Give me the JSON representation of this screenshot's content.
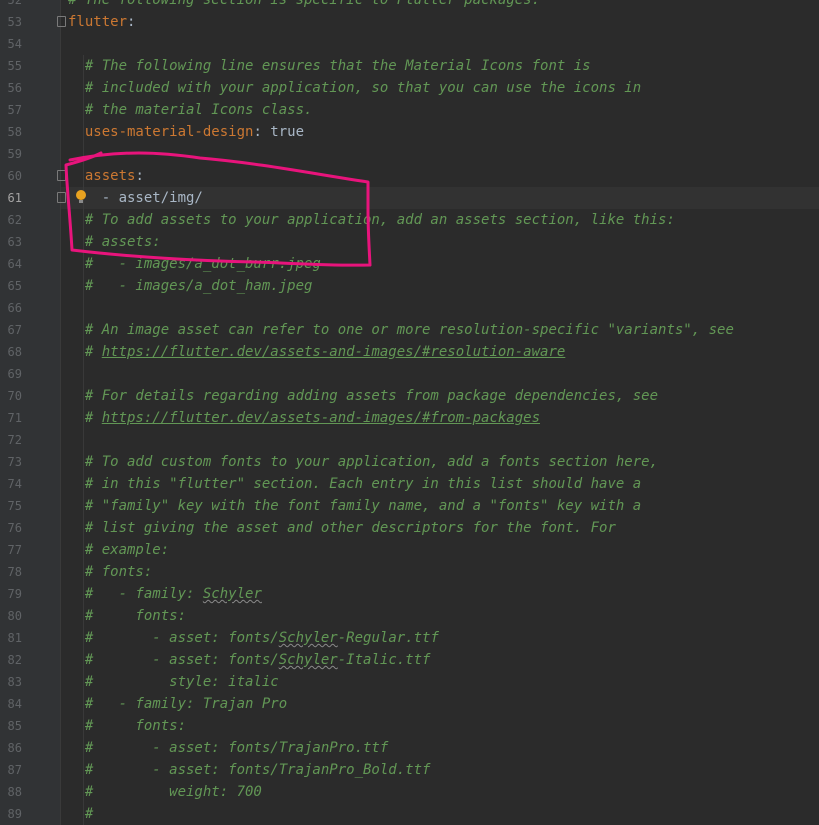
{
  "editor": {
    "current_line": "61",
    "lines": [
      {
        "num": "52",
        "text": "# The following section is specific to Flutter packages."
      },
      {
        "num": "53",
        "key": "flutter",
        "punct": ":"
      },
      {
        "num": "54"
      },
      {
        "num": "55",
        "text": "# The following line ensures that the Material Icons font is"
      },
      {
        "num": "56",
        "text": "# included with your application, so that you can use the icons in"
      },
      {
        "num": "57",
        "text": "# the material Icons class."
      },
      {
        "num": "58",
        "key": "uses-material-design",
        "punct": ": ",
        "value": "true"
      },
      {
        "num": "59"
      },
      {
        "num": "60",
        "key": "assets",
        "punct": ":"
      },
      {
        "num": "61",
        "value": "- asset/img/"
      },
      {
        "num": "62",
        "text": "# To add assets to your application, add an assets section, like this:"
      },
      {
        "num": "63",
        "text": "# assets:"
      },
      {
        "num": "64",
        "text": "#   - images/a_dot_burr.jpeg"
      },
      {
        "num": "65",
        "text": "#   - images/a_dot_ham.jpeg"
      },
      {
        "num": "66"
      },
      {
        "num": "67",
        "text": "# An image asset can refer to one or more resolution-specific \"variants\", see"
      },
      {
        "num": "68",
        "text": "# ",
        "link": "https://flutter.dev/assets-and-images/#resolution-aware"
      },
      {
        "num": "69"
      },
      {
        "num": "70",
        "text": "# For details regarding adding assets from package dependencies, see"
      },
      {
        "num": "71",
        "text": "# ",
        "link": "https://flutter.dev/assets-and-images/#from-packages"
      },
      {
        "num": "72"
      },
      {
        "num": "73",
        "text": "# To add custom fonts to your application, add a fonts section here,"
      },
      {
        "num": "74",
        "text": "# in this \"flutter\" section. Each entry in this list should have a"
      },
      {
        "num": "75",
        "text": "# \"family\" key with the font family name, and a \"fonts\" key with a"
      },
      {
        "num": "76",
        "text": "# list giving the asset and other descriptors for the font. For"
      },
      {
        "num": "77",
        "text": "# example:"
      },
      {
        "num": "78",
        "text": "# fonts:"
      },
      {
        "num": "79",
        "text": "#   - family: ",
        "squig": "Schyler"
      },
      {
        "num": "80",
        "text": "#     fonts:"
      },
      {
        "num": "81",
        "text": "#       - asset: fonts/",
        "squig": "Schyler",
        "tail": "-Regular.ttf"
      },
      {
        "num": "82",
        "text": "#       - asset: fonts/",
        "squig": "Schyler",
        "tail": "-Italic.ttf"
      },
      {
        "num": "83",
        "text": "#         style: italic"
      },
      {
        "num": "84",
        "text": "#   - family: Trajan Pro"
      },
      {
        "num": "85",
        "text": "#     fonts:"
      },
      {
        "num": "86",
        "text": "#       - asset: fonts/TrajanPro.ttf"
      },
      {
        "num": "87",
        "text": "#       - asset: fonts/TrajanPro_Bold.ttf"
      },
      {
        "num": "88",
        "text": "#         weight: 700"
      },
      {
        "num": "89",
        "text": "#"
      }
    ]
  },
  "annotation": {
    "color": "#e8147c"
  },
  "icons": {
    "intention": "lightbulb-icon",
    "fold": "fold-marker-icon"
  }
}
